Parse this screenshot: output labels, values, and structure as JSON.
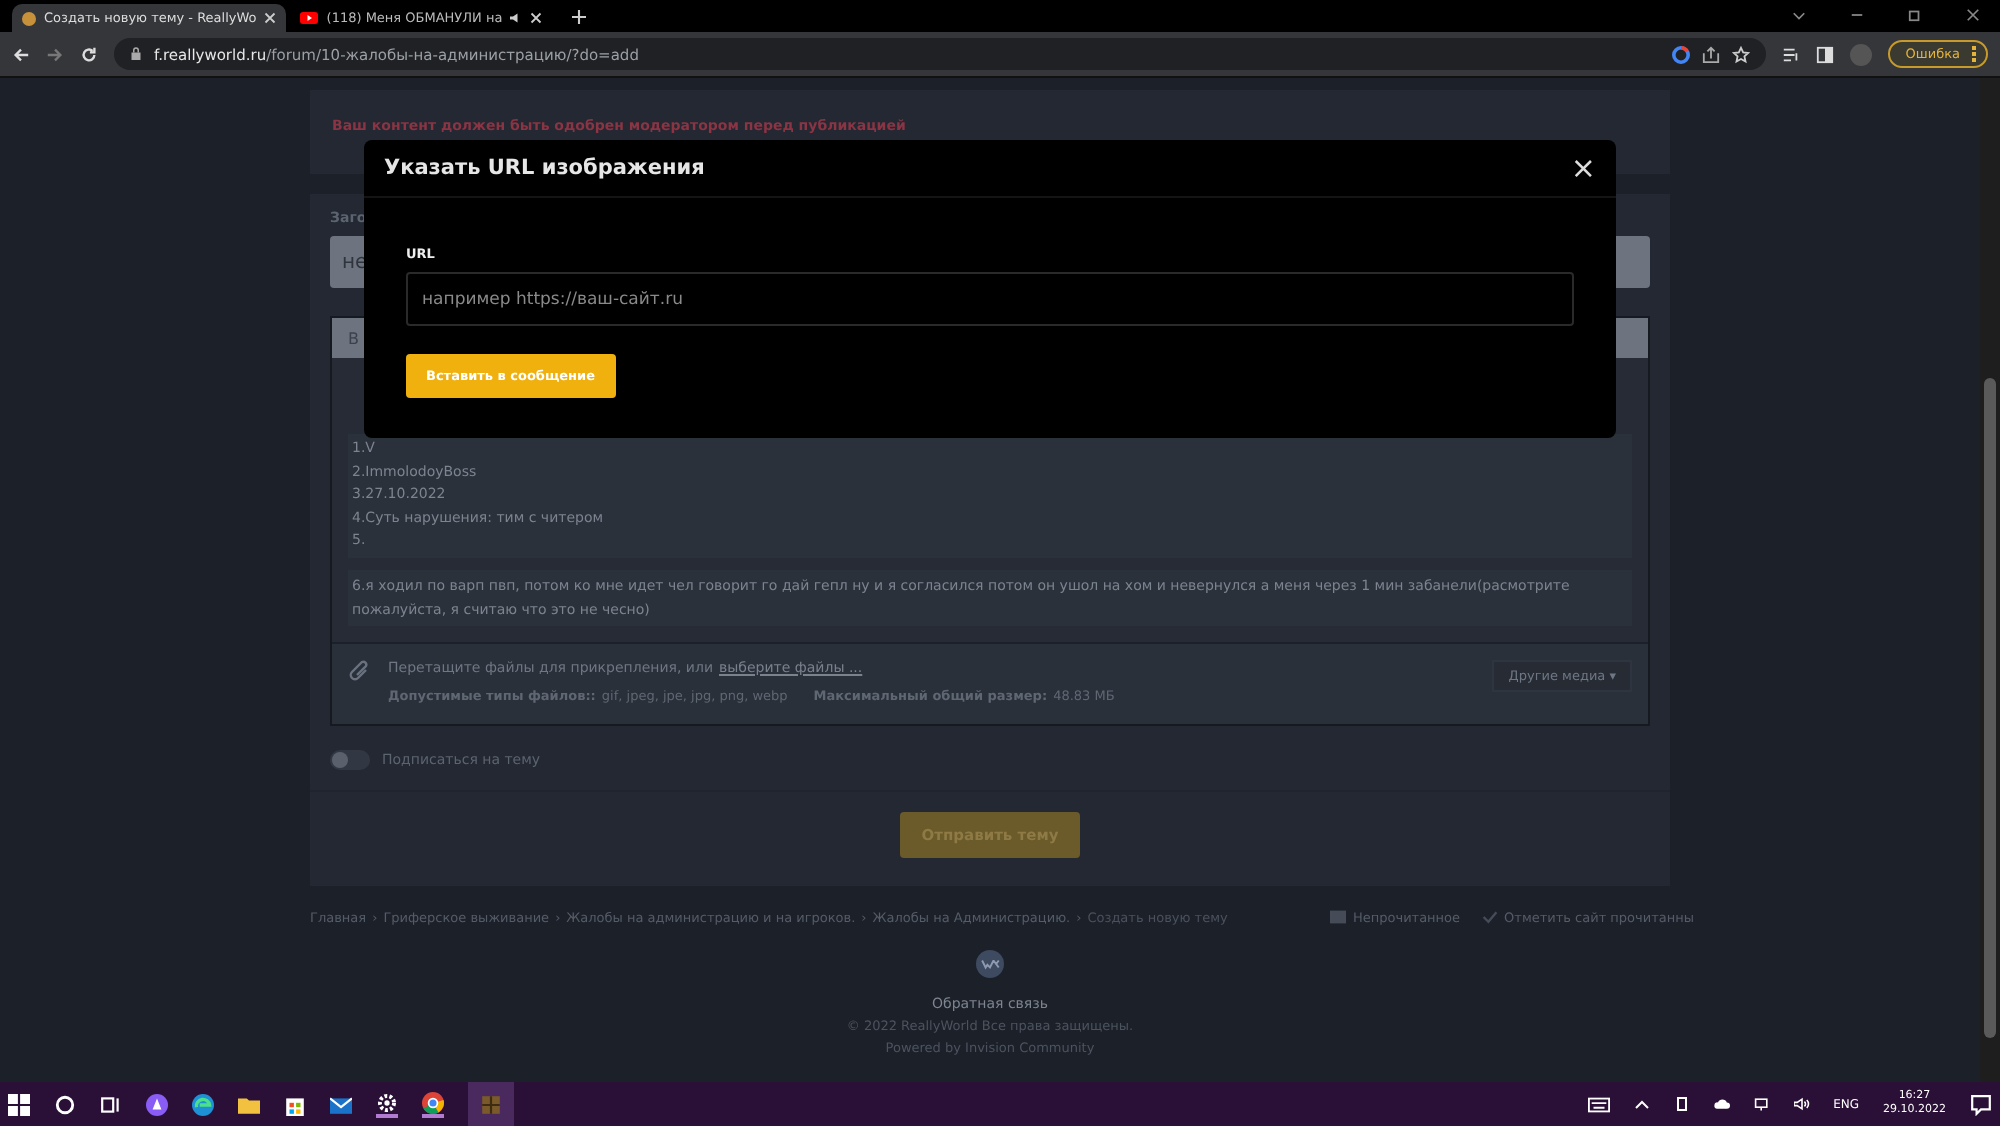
{
  "browser": {
    "tabs": [
      {
        "title": "Создать новую тему - ReallyWo",
        "selected": true
      },
      {
        "title": "(118) Меня ОБМАНУЛИ на",
        "selected": false
      }
    ],
    "url_host": "f.reallyworld.ru",
    "url_path": "/forum/10-жалобы-на-администрацию/?do=add",
    "error_button": "Ошибка"
  },
  "page": {
    "notice": "Ваш контент должен быть одобрен модератором перед публикацией",
    "title_label": "Заго",
    "title_value": "не",
    "editor_toolbar": "В",
    "editor_lines": [
      "1.V",
      "2.ImmolodoyBoss",
      "3.27.10.2022",
      "4.Суть нарушения: тим с читером",
      "5."
    ],
    "editor_paragraph": "6.я ходил по варп пвп, потом ко мне идет чел говорит го дай гепл ну и я согласился потом он ушол на хом и невернулся а меня через 1 мин забанели(расмотрите пожалуйста, я считаю что это не чесно)",
    "attach_text": "Перетащите файлы для прикрепления, или",
    "attach_link": "выберите файлы ...",
    "other_media": "Другие медиа",
    "caret": "▾",
    "types_label": "Допустимые типы файлов::",
    "types": "gif, jpeg, jpe, jpg, png, webp",
    "size_label": "Максимальный общий размер:",
    "size": "48.83 МБ",
    "subscribe": {
      "label": "Подписаться на тему",
      "on": false
    },
    "submit": "Отправить тему",
    "crumb_separator": "›",
    "breadcrumbs": [
      "Главная",
      "Гриферское выживание",
      "Жалобы на администрацию и на игроков.",
      "Жалобы на Администрацию.",
      "Создать новую тему"
    ],
    "unread": "Непрочитанное",
    "mark_read": "Отметить сайт прочитанны",
    "feedback": "Обратная связь",
    "copyright": "© 2022 ReallyWorld Все права защищены.",
    "powered": "Powered by Invision Community"
  },
  "modal": {
    "title": "Указать URL изображения",
    "close": "×",
    "field_label": "URL",
    "placeholder": "например https://ваш-сайт.ru",
    "insert_button": "Вставить в сообщение"
  },
  "taskbar": {
    "language": "ENG",
    "time": "16:27",
    "date": "29.10.2022"
  }
}
